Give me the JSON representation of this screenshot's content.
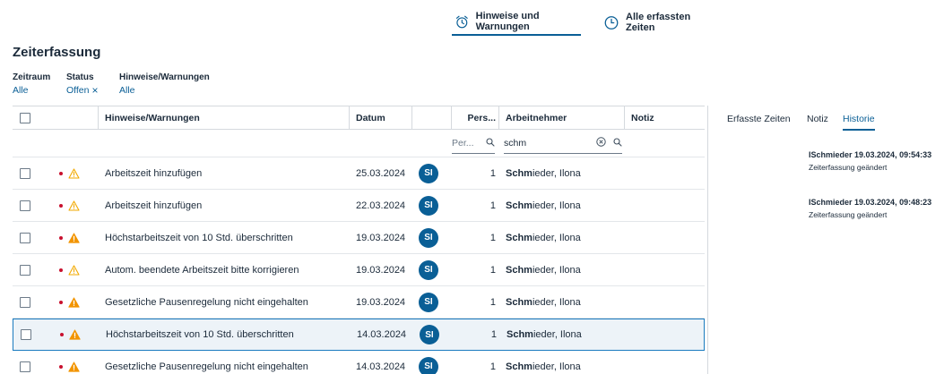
{
  "topnav": {
    "tabs": [
      {
        "label": "Hinweise und Warnungen",
        "icon": "alarm-clock-icon",
        "active": true
      },
      {
        "label": "Alle erfassten Zeiten",
        "icon": "clock-icon",
        "active": false
      }
    ]
  },
  "page": {
    "title": "Zeiterfassung"
  },
  "filters": {
    "zeitraum": {
      "label": "Zeitraum",
      "value": "Alle"
    },
    "status": {
      "label": "Status",
      "value": "Offen",
      "clear_icon": "close-icon"
    },
    "hinweise": {
      "label": "Hinweise/Warnungen",
      "value": "Alle"
    }
  },
  "table": {
    "headers": {
      "hinweise": "Hinweise/Warnungen",
      "datum": "Datum",
      "pers": "Pers...",
      "arbeitnehmer": "Arbeitnehmer",
      "notiz": "Notiz"
    },
    "filter_row": {
      "pers_placeholder": "Per...",
      "arbeitnehmer_value": "schm"
    },
    "rows": [
      {
        "warning": "Arbeitszeit hinzufügen",
        "severity": "outline",
        "datum": "25.03.2024",
        "initials": "SI",
        "pers": "1",
        "name_match": "Schm",
        "name_rest": "ieder, Ilona",
        "selected": false
      },
      {
        "warning": "Arbeitszeit hinzufügen",
        "severity": "outline",
        "datum": "22.03.2024",
        "initials": "SI",
        "pers": "1",
        "name_match": "Schm",
        "name_rest": "ieder, Ilona",
        "selected": false
      },
      {
        "warning": "Höchstarbeitszeit von 10 Std. überschritten",
        "severity": "filled",
        "datum": "19.03.2024",
        "initials": "SI",
        "pers": "1",
        "name_match": "Schm",
        "name_rest": "ieder, Ilona",
        "selected": false
      },
      {
        "warning": "Autom. beendete Arbeitszeit bitte korrigieren",
        "severity": "outline",
        "datum": "19.03.2024",
        "initials": "SI",
        "pers": "1",
        "name_match": "Schm",
        "name_rest": "ieder, Ilona",
        "selected": false
      },
      {
        "warning": "Gesetzliche Pausenregelung nicht eingehalten",
        "severity": "filled",
        "datum": "19.03.2024",
        "initials": "SI",
        "pers": "1",
        "name_match": "Schm",
        "name_rest": "ieder, Ilona",
        "selected": false
      },
      {
        "warning": "Höchstarbeitszeit von 10 Std. überschritten",
        "severity": "filled",
        "datum": "14.03.2024",
        "initials": "SI",
        "pers": "1",
        "name_match": "Schm",
        "name_rest": "ieder, Ilona",
        "selected": true
      },
      {
        "warning": "Gesetzliche Pausenregelung nicht eingehalten",
        "severity": "filled",
        "datum": "14.03.2024",
        "initials": "SI",
        "pers": "1",
        "name_match": "Schm",
        "name_rest": "ieder, Ilona",
        "selected": false
      }
    ]
  },
  "side": {
    "tabs": [
      {
        "label": "Erfasste Zeiten",
        "active": false
      },
      {
        "label": "Notiz",
        "active": false
      },
      {
        "label": "Historie",
        "active": true
      }
    ],
    "history": [
      {
        "title": "ISchmieder 19.03.2024, 09:54:33",
        "subtitle": "Zeiterfassung geändert"
      },
      {
        "title": "ISchmieder 19.03.2024, 09:48:23",
        "subtitle": "Zeiterfassung geändert"
      }
    ]
  },
  "colors": {
    "accent": "#0a5f96",
    "warning_outline": "#f2a900",
    "warning_filled": "#f29400",
    "status_dot": "#c8102e"
  }
}
